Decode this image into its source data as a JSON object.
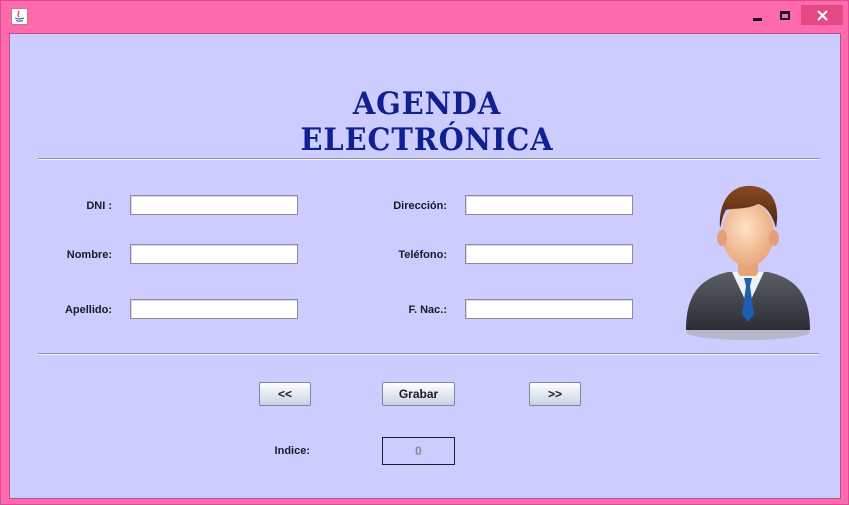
{
  "window": {
    "icon": "java-icon",
    "controls": {
      "minimize": "minimize-icon",
      "maximize": "maximize-icon",
      "close": "close-icon"
    }
  },
  "header": {
    "title": "AGENDA ELECTRÓNICA"
  },
  "form": {
    "dni_label": "DNI :",
    "nombre_label": "Nombre:",
    "apellido_label": "Apellido:",
    "direccion_label": "Dirección:",
    "telefono_label": "Teléfono:",
    "fnac_label": "F. Nac.:",
    "dni_value": "",
    "nombre_value": "",
    "apellido_value": "",
    "direccion_value": "",
    "telefono_value": "",
    "fnac_value": ""
  },
  "buttons": {
    "prev": "<<",
    "save": "Grabar",
    "next": ">>"
  },
  "indice": {
    "label": "Indice:",
    "value": "0"
  },
  "image": {
    "icon": "user-avatar-icon"
  },
  "colors": {
    "frame": "#ff6aae",
    "background": "#ccccff",
    "title": "#10208f"
  }
}
